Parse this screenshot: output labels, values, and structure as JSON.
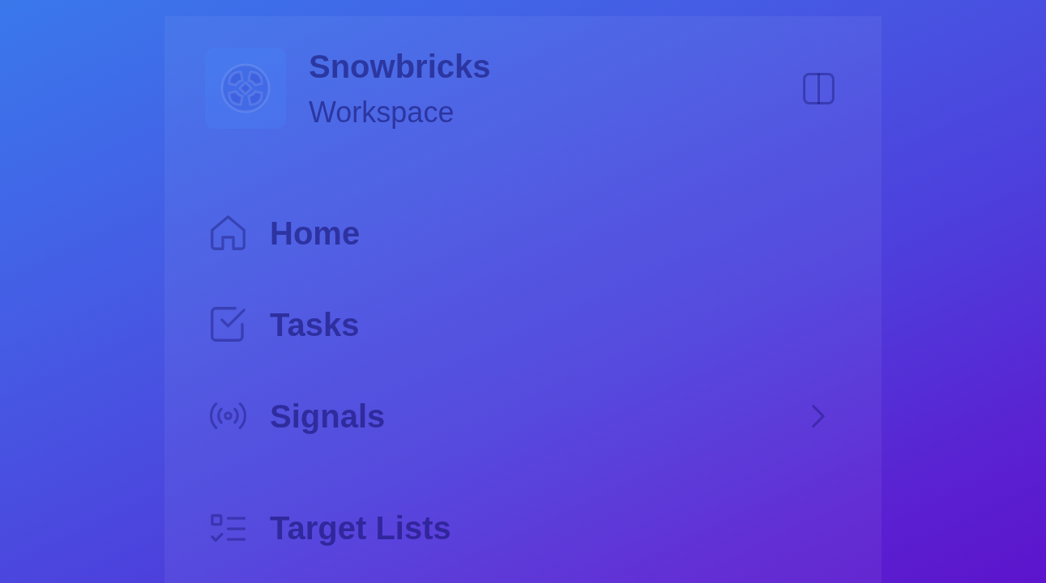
{
  "sidebar": {
    "brand": {
      "name": "Snowbricks",
      "subtitle": "Workspace"
    },
    "sections": [
      {
        "items": [
          {
            "label": "Home",
            "kind": "link"
          },
          {
            "label": "Tasks",
            "kind": "link"
          },
          {
            "label": "Signals",
            "kind": "group"
          }
        ]
      },
      {
        "items": [
          {
            "label": "Target Lists",
            "kind": "link"
          }
        ]
      }
    ]
  }
}
